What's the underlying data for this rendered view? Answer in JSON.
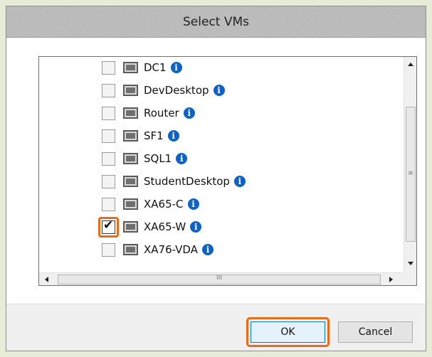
{
  "dialog": {
    "title": "Select VMs",
    "vms": [
      {
        "name": "DC1",
        "checked": false
      },
      {
        "name": "DevDesktop",
        "checked": false
      },
      {
        "name": "Router",
        "checked": false
      },
      {
        "name": "SF1",
        "checked": false
      },
      {
        "name": "SQL1",
        "checked": false
      },
      {
        "name": "StudentDesktop",
        "checked": false
      },
      {
        "name": "XA65-C",
        "checked": false
      },
      {
        "name": "XA65-W",
        "checked": true
      },
      {
        "name": "XA76-VDA",
        "checked": false
      }
    ],
    "info_glyph": "i",
    "check_glyph": "✔",
    "scroll_grip_v": "≡",
    "scroll_grip_h": "III",
    "ok_label": "OK",
    "cancel_label": "Cancel"
  },
  "colors": {
    "highlight": "#ea6a16",
    "info": "#0c62c7",
    "titlebar": "#b9b9b9"
  },
  "icons": {
    "vm": "monitor-icon",
    "info": "info-icon",
    "check": "checkmark-icon"
  }
}
